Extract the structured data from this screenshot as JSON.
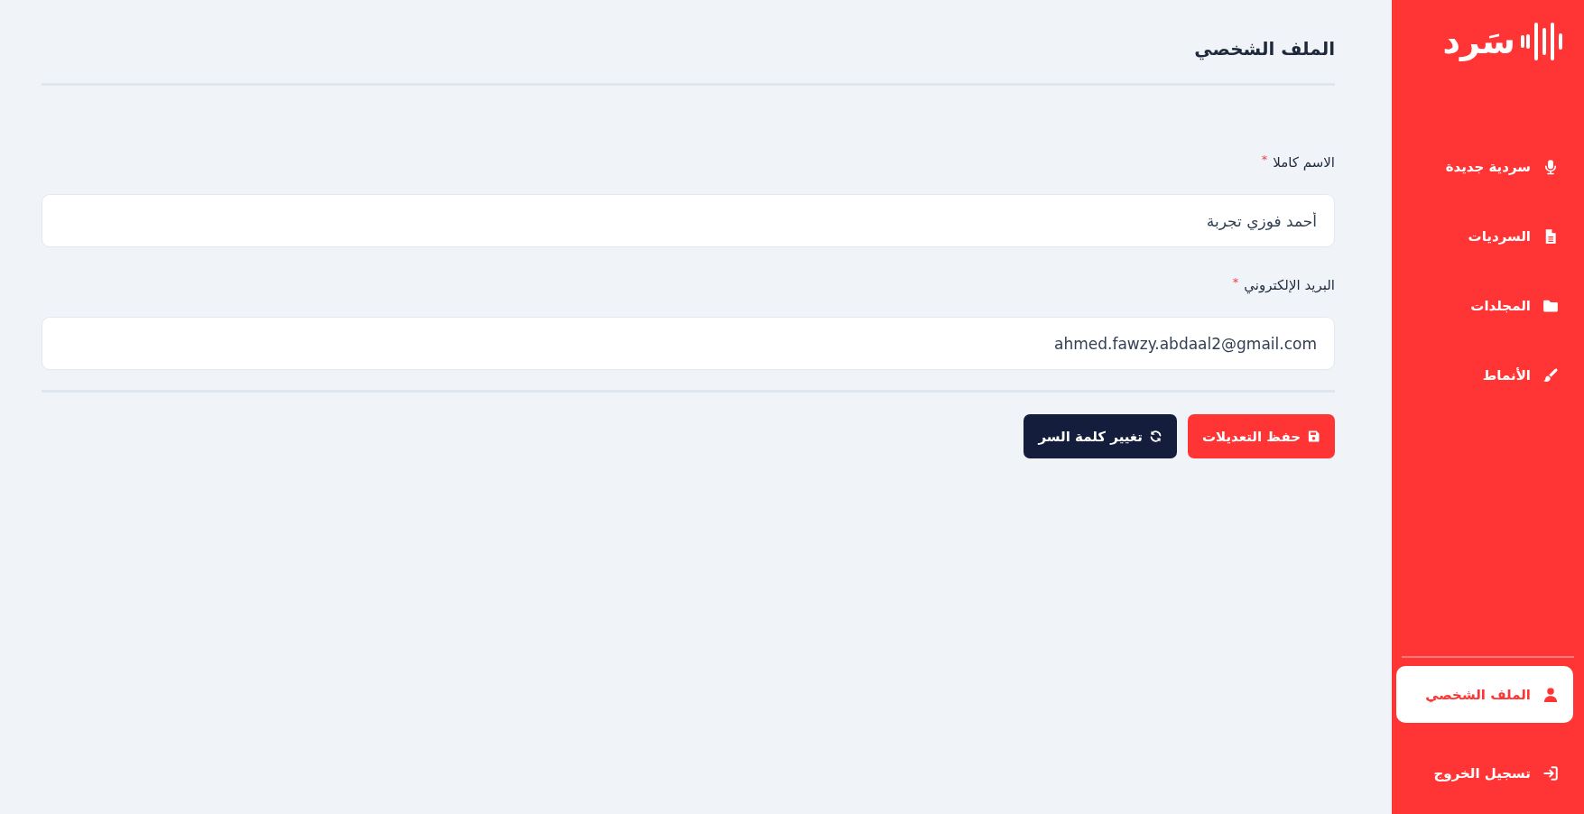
{
  "sidebar": {
    "logo": "سَرد",
    "items": [
      {
        "label": "سردية جديدة",
        "selected": false
      },
      {
        "label": "السرديات",
        "selected": false
      },
      {
        "label": "المجلدات",
        "selected": false
      },
      {
        "label": "الأنماط",
        "selected": false
      }
    ],
    "account_items": [
      {
        "label": "الملف الشخصي",
        "selected": true
      }
    ],
    "logout": {
      "label": "تسجيل الخروج"
    }
  },
  "page": {
    "title": "الملف الشخصي"
  },
  "form": {
    "fields": [
      {
        "label": "الاسم كاملا",
        "required_mark": "*",
        "value": "أحمد فوزي تجربة"
      },
      {
        "label": "البريد الإلكتروني",
        "required_mark": "*",
        "value": "ahmed.fawzy.abdaal2@gmail.com"
      }
    ],
    "buttons": [
      {
        "label": "حفظ التعديلات",
        "kind": "primary"
      },
      {
        "label": "تغيير كلمة السر",
        "kind": "dark"
      }
    ]
  }
}
